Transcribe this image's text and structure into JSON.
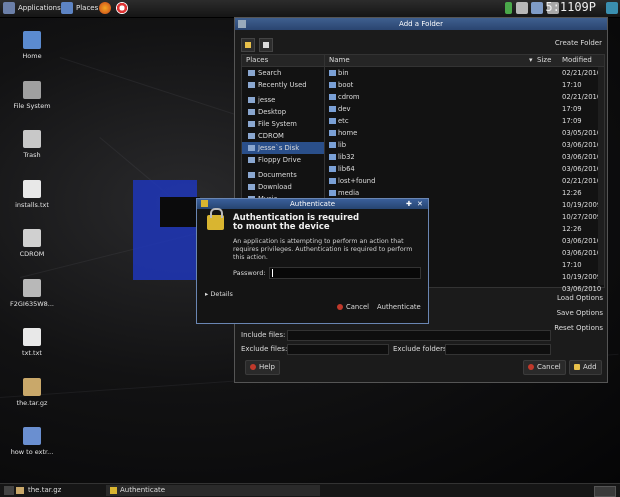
{
  "top_panel": {
    "applications": "Applications",
    "places": "Places",
    "clock": "5:11 PM",
    "clock_display": "5:1109P"
  },
  "desktop_icons": [
    {
      "label": "Home",
      "icon": "home-folder-icon",
      "color": "#5b8bd0"
    },
    {
      "label": "File System",
      "icon": "harddisk-icon",
      "color": "#a0a0a0"
    },
    {
      "label": "Trash",
      "icon": "trash-icon",
      "color": "#c8c8c8"
    },
    {
      "label": "installs.txt",
      "icon": "text-file-icon",
      "color": "#e8e8e8"
    },
    {
      "label": "CDROM",
      "icon": "cdrom-icon",
      "color": "#d0d0d0"
    },
    {
      "label": "F2GI635W8...",
      "icon": "gear-icon",
      "color": "#b8b8b8"
    },
    {
      "label": "txt.txt",
      "icon": "text-file-icon",
      "color": "#e8e8e8"
    },
    {
      "label": "the.tar.gz",
      "icon": "archive-icon",
      "color": "#c9a86a"
    },
    {
      "label": "how to extr...",
      "icon": "image-file-icon",
      "color": "#6a8fd0"
    }
  ],
  "file_dialog": {
    "title": "Add a Folder",
    "create_folder": "Create Folder",
    "places_header": "Places",
    "name_header": "Name",
    "size_header": "Size",
    "modified_header": "Modified",
    "places": [
      "Search",
      "Recently Used",
      "jesse",
      "Desktop",
      "File System",
      "CDROM",
      "Jesse`s Disk",
      "Floppy Drive",
      "Documents",
      "Download",
      "Music"
    ],
    "files": [
      {
        "name": "bin",
        "modified": "02/21/2010"
      },
      {
        "name": "boot",
        "modified": "17:10"
      },
      {
        "name": "cdrom",
        "modified": "02/21/2010"
      },
      {
        "name": "dev",
        "modified": "17:09"
      },
      {
        "name": "etc",
        "modified": "17:09"
      },
      {
        "name": "home",
        "modified": "03/05/2010"
      },
      {
        "name": "lib",
        "modified": "03/06/2010"
      },
      {
        "name": "lib32",
        "modified": "03/06/2010"
      },
      {
        "name": "lib64",
        "modified": "03/06/2010"
      },
      {
        "name": "lost+found",
        "modified": "02/21/2010"
      },
      {
        "name": "media",
        "modified": "12:26"
      },
      {
        "name": "",
        "modified": "10/19/2009"
      },
      {
        "name": "",
        "modified": "10/27/2009"
      },
      {
        "name": "",
        "modified": "12:26"
      },
      {
        "name": "",
        "modified": "03/06/2010"
      },
      {
        "name": "",
        "modified": "03/06/2010"
      },
      {
        "name": "",
        "modified": "17:10"
      },
      {
        "name": "",
        "modified": "10/19/2009"
      },
      {
        "name": "",
        "modified": "03/06/2010"
      }
    ],
    "load_options": "Load Options",
    "save_options": "Save Options",
    "reset_options": "Reset Options",
    "include_files_label": "Include files:",
    "exclude_files_label": "Exclude files:",
    "exclude_folders_label": "Exclude folders:",
    "help": "Help",
    "cancel": "Cancel",
    "add": "Add"
  },
  "auth_dialog": {
    "title": "Authenticate",
    "heading_line1": "Authentication is required",
    "heading_line2": "to mount the device",
    "description": "An application is attempting to perform an action that requires privileges. Authentication is required to perform this action.",
    "password_label": "Password:",
    "password_value": "",
    "details": "Details",
    "cancel": "Cancel",
    "authenticate": "Authenticate"
  },
  "taskbar": {
    "items": [
      "the.tar.gz",
      "Authenticate"
    ]
  }
}
